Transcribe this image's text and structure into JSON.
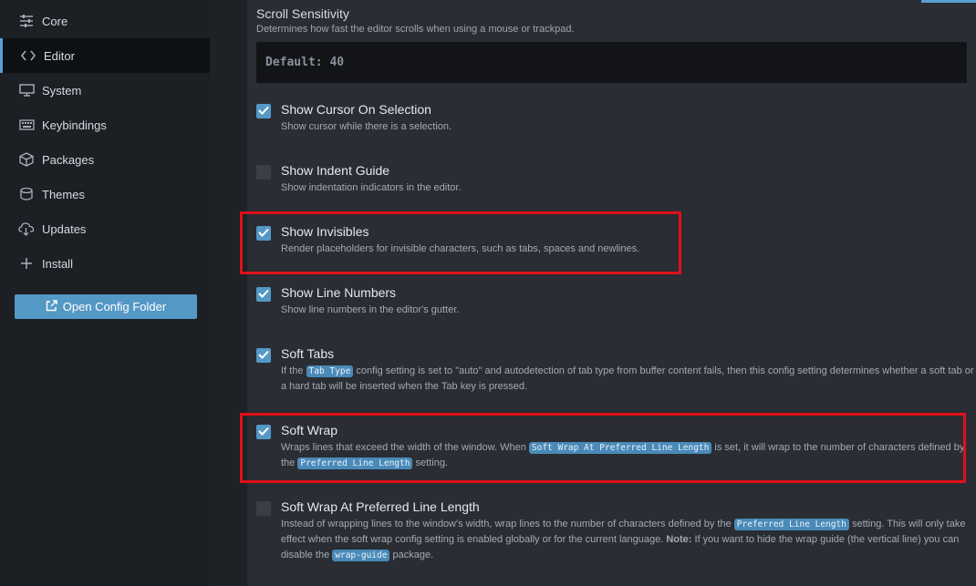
{
  "sidebar": {
    "items": [
      {
        "label": "Core",
        "icon": "sliders-icon"
      },
      {
        "label": "Editor",
        "icon": "code-icon"
      },
      {
        "label": "System",
        "icon": "monitor-icon"
      },
      {
        "label": "Keybindings",
        "icon": "keyboard-icon"
      },
      {
        "label": "Packages",
        "icon": "package-icon"
      },
      {
        "label": "Themes",
        "icon": "paintcan-icon"
      },
      {
        "label": "Updates",
        "icon": "cloud-download-icon"
      },
      {
        "label": "Install",
        "icon": "plus-icon"
      }
    ],
    "active": "Editor",
    "open_config_label": "Open Config Folder"
  },
  "main": {
    "scroll_sensitivity": {
      "title": "Scroll Sensitivity",
      "description": "Determines how fast the editor scrolls when using a mouse or trackpad.",
      "placeholder": "Default: 40"
    },
    "settings": [
      {
        "title": "Show Cursor On Selection",
        "checked": true,
        "desc": [
          "Show cursor while there is a selection."
        ]
      },
      {
        "title": "Show Indent Guide",
        "checked": false,
        "desc": [
          "Show indentation indicators in the editor."
        ]
      },
      {
        "title": "Show Invisibles",
        "checked": true,
        "desc": [
          "Render placeholders for invisible characters, such as tabs, spaces and newlines."
        ]
      },
      {
        "title": "Show Line Numbers",
        "checked": true,
        "desc": [
          "Show line numbers in the editor's gutter."
        ]
      },
      {
        "title": "Soft Tabs",
        "checked": true,
        "desc": [
          "If the ",
          "Tab Type",
          " config setting is set to \"auto\" and autodetection of tab type from buffer content fails, then this config setting determines whether a soft tab or a hard tab will be inserted when the Tab key is pressed."
        ]
      },
      {
        "title": "Soft Wrap",
        "checked": true,
        "desc": [
          "Wraps lines that exceed the width of the window. When ",
          "Soft Wrap At Preferred Line Length",
          " is set, it will wrap to the number of characters defined by the ",
          "Preferred Line Length",
          " setting."
        ]
      },
      {
        "title": "Soft Wrap At Preferred Line Length",
        "checked": false,
        "desc": [
          "Instead of wrapping lines to the window's width, wrap lines to the number of characters defined by the ",
          "Preferred Line Length",
          " setting. This will only take effect when the soft wrap config setting is enabled globally or for the current language. ",
          "Note:",
          " If you want to hide the wrap guide (the vertical line) you can disable the ",
          "wrap-guide",
          " package."
        ]
      }
    ]
  },
  "colors": {
    "accent": "#5498c6",
    "highlight": "#e0101a"
  }
}
